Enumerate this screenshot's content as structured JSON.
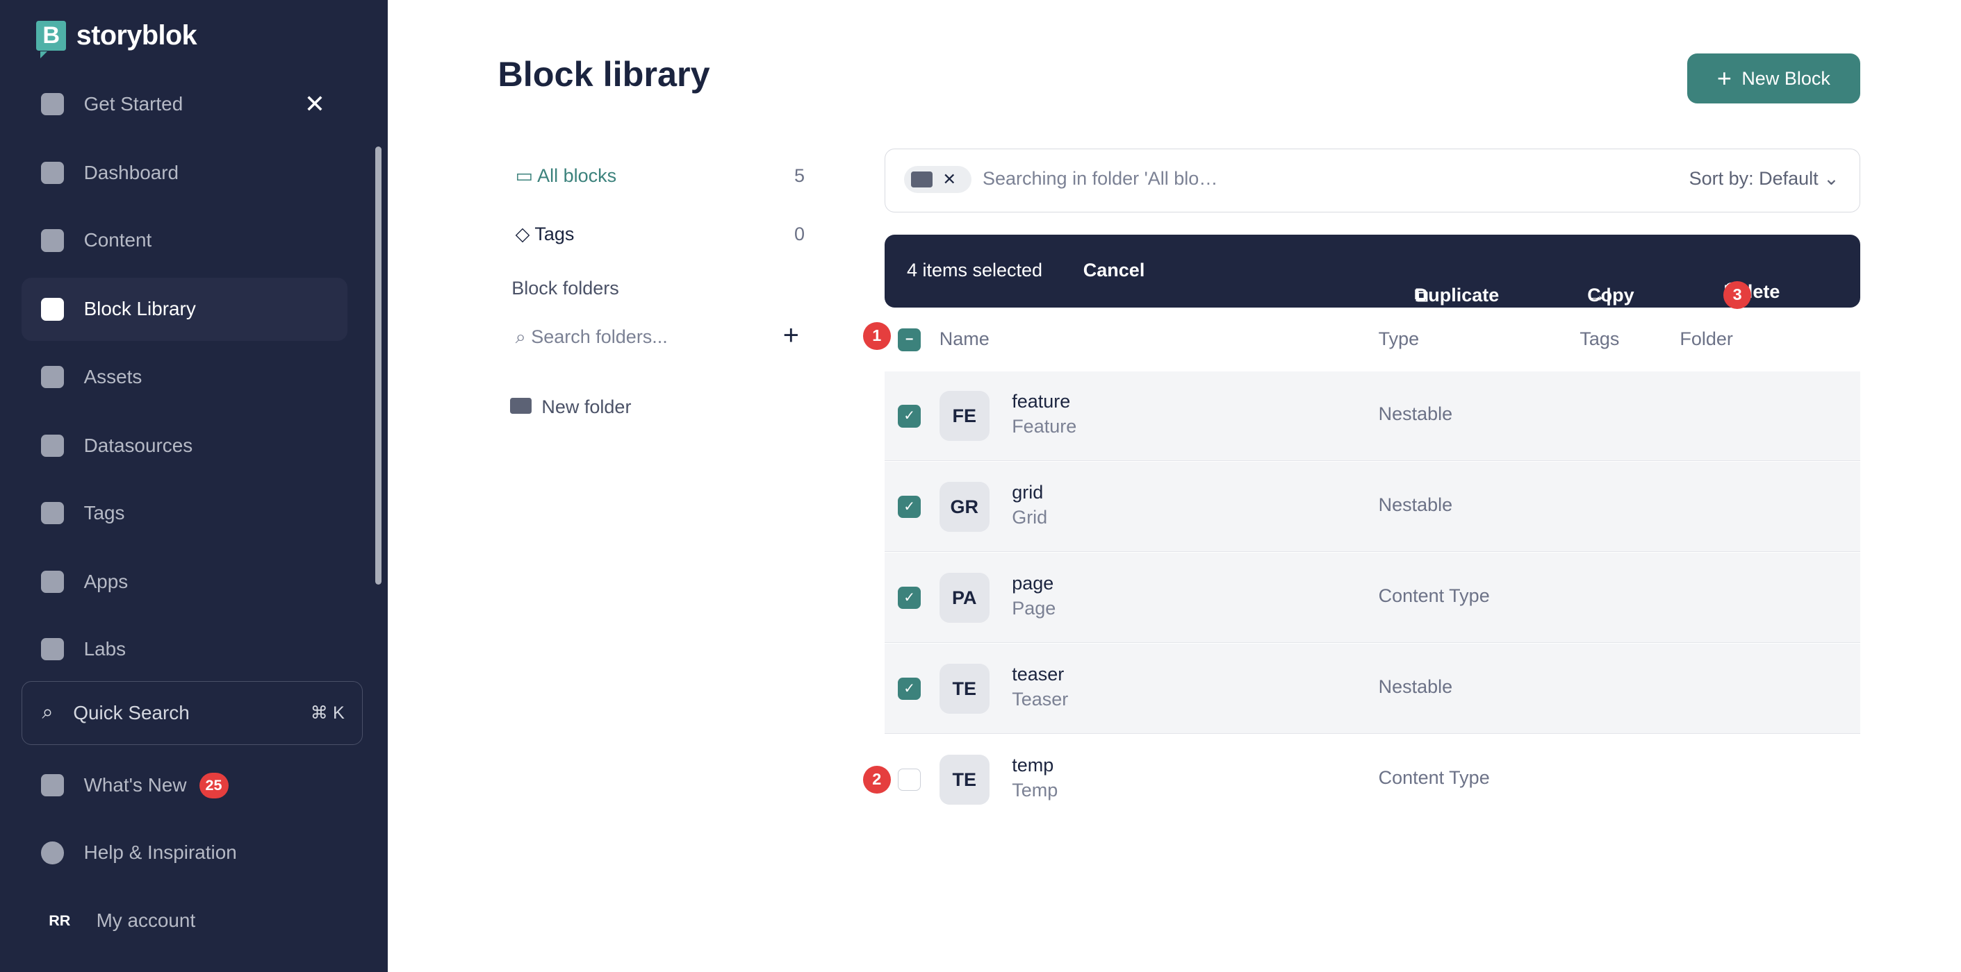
{
  "brand": "storyblok",
  "sidebar": {
    "items": [
      {
        "label": "Get Started",
        "icon": "wave-icon"
      },
      {
        "label": "Dashboard",
        "icon": "dashboard-icon"
      },
      {
        "label": "Content",
        "icon": "content-icon"
      },
      {
        "label": "Block Library",
        "icon": "block-library-icon",
        "active": true
      },
      {
        "label": "Assets",
        "icon": "assets-icon"
      },
      {
        "label": "Datasources",
        "icon": "datasources-icon"
      },
      {
        "label": "Tags",
        "icon": "tag-icon"
      },
      {
        "label": "Apps",
        "icon": "apps-icon"
      },
      {
        "label": "Labs",
        "icon": "flask-icon"
      }
    ],
    "quick_search": "Quick Search",
    "shortcut": "⌘ K",
    "whats_new": "What's New",
    "whats_new_count": "25",
    "help": "Help & Inspiration",
    "account_initials": "RR",
    "account": "My account"
  },
  "header": {
    "title": "Block library",
    "new_block": "New Block"
  },
  "left": {
    "all_blocks": "All blocks",
    "all_count": "5",
    "tags": "Tags",
    "tags_count": "0",
    "folders_heading": "Block folders",
    "search_placeholder": "Search folders...",
    "new_folder": "New folder"
  },
  "search": {
    "text": "Searching in folder 'All blo…",
    "sort": "Sort by: Default"
  },
  "actionbar": {
    "selected": "4 items selected",
    "cancel": "Cancel",
    "duplicate": "Duplicate",
    "copy": "Copy",
    "delete": "Delete"
  },
  "markers": [
    "1",
    "2",
    "3"
  ],
  "table": {
    "headers": [
      "Name",
      "Type",
      "Tags",
      "Folder"
    ],
    "rows": [
      {
        "initials": "FE",
        "name": "feature",
        "display": "Feature",
        "type": "Nestable",
        "checked": true
      },
      {
        "initials": "GR",
        "name": "grid",
        "display": "Grid",
        "type": "Nestable",
        "checked": true
      },
      {
        "initials": "PA",
        "name": "page",
        "display": "Page",
        "type": "Content Type",
        "checked": true
      },
      {
        "initials": "TE",
        "name": "teaser",
        "display": "Teaser",
        "type": "Nestable",
        "checked": true
      },
      {
        "initials": "TE",
        "name": "temp",
        "display": "Temp",
        "type": "Content Type",
        "checked": false
      }
    ]
  },
  "colors": {
    "sidebar": "#1f2640",
    "accent": "#3c827c",
    "badge": "#e53e3e"
  }
}
